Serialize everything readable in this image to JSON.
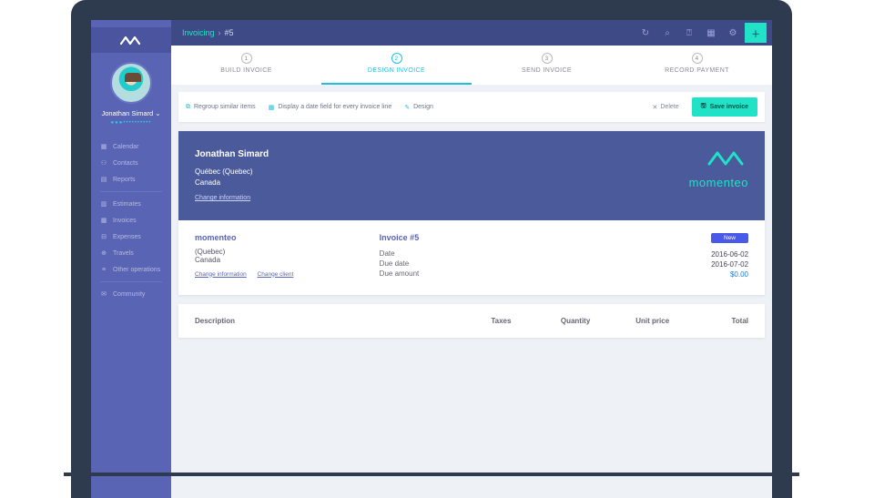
{
  "breadcrumb": {
    "section": "Invoicing",
    "item": "#5"
  },
  "user": {
    "name": "Jonathan Simard"
  },
  "sidebar": {
    "items": [
      {
        "label": "Calendar",
        "icon": "calendar-icon"
      },
      {
        "label": "Contacts",
        "icon": "contacts-icon"
      },
      {
        "label": "Reports",
        "icon": "reports-icon"
      }
    ],
    "group2": [
      {
        "label": "Estimates",
        "icon": "estimates-icon"
      },
      {
        "label": "Invoices",
        "icon": "invoices-icon"
      },
      {
        "label": "Expenses",
        "icon": "expenses-icon"
      },
      {
        "label": "Travels",
        "icon": "travels-icon"
      },
      {
        "label": "Other operations",
        "icon": "other-icon"
      }
    ],
    "group3": [
      {
        "label": "Community",
        "icon": "community-icon"
      }
    ]
  },
  "steps": [
    {
      "num": "1",
      "label": "BUILD INVOICE"
    },
    {
      "num": "2",
      "label": "DESIGN INVOICE"
    },
    {
      "num": "3",
      "label": "SEND INVOICE"
    },
    {
      "num": "4",
      "label": "RECORD PAYMENT"
    }
  ],
  "toolbar": {
    "regroup": "Regroup similar items",
    "dateField": "Display a date field for every invoice line",
    "design": "Design",
    "delete": "Delete",
    "save": "Save invoice"
  },
  "hero": {
    "name": "Jonathan Simard",
    "addr1": "Québec (Quebec)",
    "addr2": "Canada",
    "changeInfo": "Change information",
    "brand": "momenteo"
  },
  "details": {
    "company": "momenteo",
    "compAddr1": "(Quebec)",
    "compAddr2": "Canada",
    "link1": "Change information",
    "link2": "Change client",
    "invoiceTitle": "Invoice #5",
    "dateLabel": "Date",
    "dueDateLabel": "Due date",
    "dueAmtLabel": "Due amount",
    "badge": "New",
    "date": "2016-06-02",
    "dueDate": "2016-07-02",
    "amount": "$0.00"
  },
  "lineHeaders": {
    "desc": "Description",
    "taxes": "Taxes",
    "qty": "Quantity",
    "unit": "Unit price",
    "total": "Total"
  }
}
